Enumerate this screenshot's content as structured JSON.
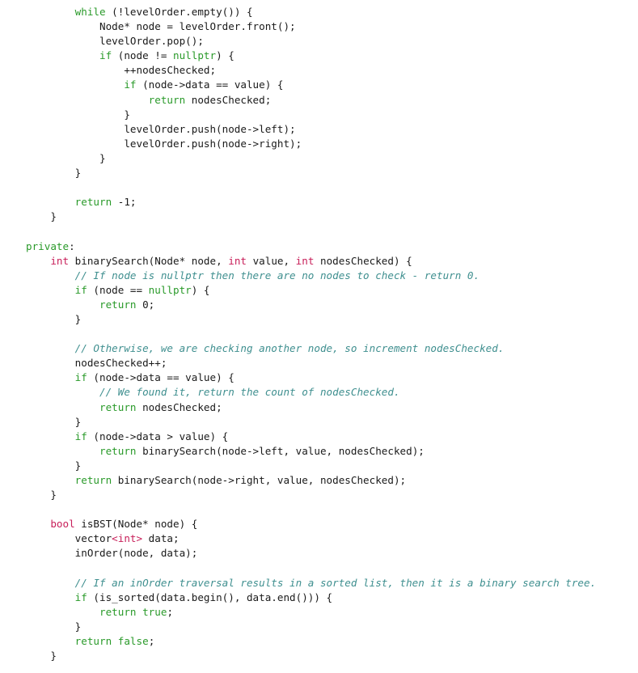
{
  "document": {
    "kind": "code-listing",
    "language": "C++",
    "colors": {
      "keyword": "#2a9a2a",
      "type": "#c8205a",
      "comment": "#3f8f8f",
      "text": "#1a1a1a",
      "background": "#ffffff"
    },
    "lines": [
      {
        "indent": 2,
        "tokens": [
          [
            "kw",
            "while"
          ],
          [
            "tx",
            " (!levelOrder.empty()) {"
          ]
        ]
      },
      {
        "indent": 3,
        "tokens": [
          [
            "tx",
            "Node* node = levelOrder.front();"
          ]
        ]
      },
      {
        "indent": 3,
        "tokens": [
          [
            "tx",
            "levelOrder.pop();"
          ]
        ]
      },
      {
        "indent": 3,
        "tokens": [
          [
            "kw",
            "if"
          ],
          [
            "tx",
            " (node != "
          ],
          [
            "kw",
            "nullptr"
          ],
          [
            "tx",
            ") {"
          ]
        ]
      },
      {
        "indent": 4,
        "tokens": [
          [
            "tx",
            "++nodesChecked;"
          ]
        ]
      },
      {
        "indent": 4,
        "tokens": [
          [
            "kw",
            "if"
          ],
          [
            "tx",
            " (node->data == value) {"
          ]
        ]
      },
      {
        "indent": 5,
        "tokens": [
          [
            "kw",
            "return"
          ],
          [
            "tx",
            " nodesChecked;"
          ]
        ]
      },
      {
        "indent": 4,
        "tokens": [
          [
            "tx",
            "}"
          ]
        ]
      },
      {
        "indent": 4,
        "tokens": [
          [
            "tx",
            "levelOrder.push(node->left);"
          ]
        ]
      },
      {
        "indent": 4,
        "tokens": [
          [
            "tx",
            "levelOrder.push(node->right);"
          ]
        ]
      },
      {
        "indent": 3,
        "tokens": [
          [
            "tx",
            "}"
          ]
        ]
      },
      {
        "indent": 2,
        "tokens": [
          [
            "tx",
            "}"
          ]
        ]
      },
      {
        "indent": 0,
        "tokens": []
      },
      {
        "indent": 2,
        "tokens": [
          [
            "kw",
            "return"
          ],
          [
            "tx",
            " -1;"
          ]
        ]
      },
      {
        "indent": 1,
        "tokens": [
          [
            "tx",
            "}"
          ]
        ]
      },
      {
        "indent": 0,
        "tokens": []
      },
      {
        "indent": 0,
        "tokens": [
          [
            "kw",
            "private"
          ],
          [
            "tx",
            ":"
          ]
        ]
      },
      {
        "indent": 1,
        "tokens": [
          [
            "type",
            "int"
          ],
          [
            "tx",
            " binarySearch(Node* node, "
          ],
          [
            "type",
            "int"
          ],
          [
            "tx",
            " value, "
          ],
          [
            "type",
            "int"
          ],
          [
            "tx",
            " nodesChecked) {"
          ]
        ]
      },
      {
        "indent": 2,
        "tokens": [
          [
            "cm",
            "// If node is nullptr then there are no nodes to check - return 0."
          ]
        ]
      },
      {
        "indent": 2,
        "tokens": [
          [
            "kw",
            "if"
          ],
          [
            "tx",
            " (node == "
          ],
          [
            "kw",
            "nullptr"
          ],
          [
            "tx",
            ") {"
          ]
        ]
      },
      {
        "indent": 3,
        "tokens": [
          [
            "kw",
            "return"
          ],
          [
            "tx",
            " 0;"
          ]
        ]
      },
      {
        "indent": 2,
        "tokens": [
          [
            "tx",
            "}"
          ]
        ]
      },
      {
        "indent": 0,
        "tokens": []
      },
      {
        "indent": 2,
        "tokens": [
          [
            "cm",
            "// Otherwise, we are checking another node, so increment nodesChecked."
          ]
        ]
      },
      {
        "indent": 2,
        "tokens": [
          [
            "tx",
            "nodesChecked++;"
          ]
        ]
      },
      {
        "indent": 2,
        "tokens": [
          [
            "kw",
            "if"
          ],
          [
            "tx",
            " (node->data == value) {"
          ]
        ]
      },
      {
        "indent": 3,
        "tokens": [
          [
            "cm",
            "// We found it, return the count of nodesChecked."
          ]
        ]
      },
      {
        "indent": 3,
        "tokens": [
          [
            "kw",
            "return"
          ],
          [
            "tx",
            " nodesChecked;"
          ]
        ]
      },
      {
        "indent": 2,
        "tokens": [
          [
            "tx",
            "}"
          ]
        ]
      },
      {
        "indent": 2,
        "tokens": [
          [
            "kw",
            "if"
          ],
          [
            "tx",
            " (node->data > value) {"
          ]
        ]
      },
      {
        "indent": 3,
        "tokens": [
          [
            "kw",
            "return"
          ],
          [
            "tx",
            " binarySearch(node->left, value, nodesChecked);"
          ]
        ]
      },
      {
        "indent": 2,
        "tokens": [
          [
            "tx",
            "}"
          ]
        ]
      },
      {
        "indent": 2,
        "tokens": [
          [
            "kw",
            "return"
          ],
          [
            "tx",
            " binarySearch(node->right, value, nodesChecked);"
          ]
        ]
      },
      {
        "indent": 1,
        "tokens": [
          [
            "tx",
            "}"
          ]
        ]
      },
      {
        "indent": 0,
        "tokens": []
      },
      {
        "indent": 1,
        "tokens": [
          [
            "type",
            "bool"
          ],
          [
            "tx",
            " isBST(Node* node) {"
          ]
        ]
      },
      {
        "indent": 2,
        "tokens": [
          [
            "tx",
            "vector"
          ],
          [
            "type",
            "<int>"
          ],
          [
            "tx",
            " data;"
          ]
        ]
      },
      {
        "indent": 2,
        "tokens": [
          [
            "tx",
            "inOrder(node, data);"
          ]
        ]
      },
      {
        "indent": 0,
        "tokens": []
      },
      {
        "indent": 2,
        "tokens": [
          [
            "cm",
            "// If an inOrder traversal results in a sorted list, then it is a binary search tree."
          ]
        ]
      },
      {
        "indent": 2,
        "tokens": [
          [
            "kw",
            "if"
          ],
          [
            "tx",
            " (is_sorted(data.begin(), data.end())) {"
          ]
        ]
      },
      {
        "indent": 3,
        "tokens": [
          [
            "kw",
            "return"
          ],
          [
            "tx",
            " "
          ],
          [
            "kw",
            "true"
          ],
          [
            "tx",
            ";"
          ]
        ]
      },
      {
        "indent": 2,
        "tokens": [
          [
            "tx",
            "}"
          ]
        ]
      },
      {
        "indent": 2,
        "tokens": [
          [
            "kw",
            "return"
          ],
          [
            "tx",
            " "
          ],
          [
            "kw",
            "false"
          ],
          [
            "tx",
            ";"
          ]
        ]
      },
      {
        "indent": 1,
        "tokens": [
          [
            "tx",
            "}"
          ]
        ]
      }
    ]
  }
}
